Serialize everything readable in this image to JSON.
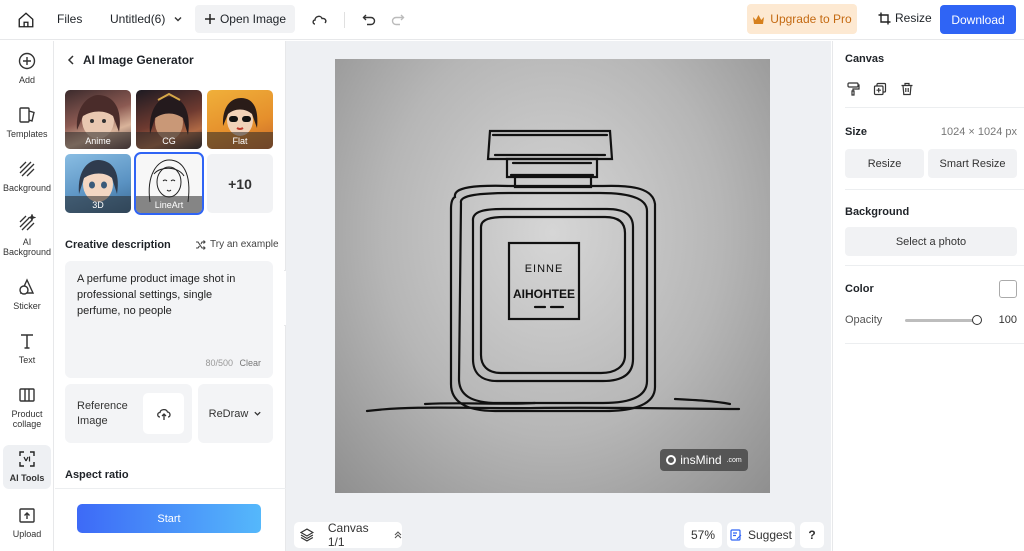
{
  "topbar": {
    "files": "Files",
    "doc_title": "Untitled(6)",
    "open_image": "Open Image",
    "upgrade": "Upgrade to Pro",
    "resize": "Resize",
    "download": "Download"
  },
  "rail": {
    "items": [
      {
        "label": "Add",
        "icon": "plus-circle-icon"
      },
      {
        "label": "Templates",
        "icon": "templates-icon"
      },
      {
        "label": "Background",
        "icon": "background-icon"
      },
      {
        "label": "AI Background",
        "icon": "ai-background-icon"
      },
      {
        "label": "Sticker",
        "icon": "sticker-icon"
      },
      {
        "label": "Text",
        "icon": "text-icon"
      },
      {
        "label": "Product collage",
        "icon": "collage-icon"
      },
      {
        "label": "AI Tools",
        "icon": "ai-tools-icon"
      },
      {
        "label": "Upload",
        "icon": "upload-icon"
      }
    ]
  },
  "panel": {
    "title": "AI Image Generator",
    "styles": [
      {
        "label": "Anime"
      },
      {
        "label": "CG"
      },
      {
        "label": "Flat"
      },
      {
        "label": "3D"
      },
      {
        "label": "LineArt",
        "selected": true
      }
    ],
    "more_styles": "+10",
    "creative_title": "Creative description",
    "try_example": "Try an example",
    "description": "A perfume product image shot in professional settings, single perfume, no people",
    "count": "80/500",
    "clear": "Clear",
    "reference_label": "Reference Image",
    "redraw": "ReDraw",
    "aspect_title": "Aspect ratio",
    "start": "Start"
  },
  "canvas": {
    "label_line1": "EINNE",
    "label_line2": "AIHOHTEE",
    "watermark": "insMind",
    "watermark_suffix": ".com",
    "page_label": "Canvas 1/1",
    "zoom": "57%",
    "suggest": "Suggest",
    "help": "?"
  },
  "right": {
    "canvas_title": "Canvas",
    "size_title": "Size",
    "size_value": "1024 × 1024 px",
    "resize": "Resize",
    "smart_resize": "Smart Resize",
    "background_title": "Background",
    "select_photo": "Select a photo",
    "color_title": "Color",
    "opacity_label": "Opacity",
    "opacity_value": "100",
    "opacity_level": 1.0
  }
}
